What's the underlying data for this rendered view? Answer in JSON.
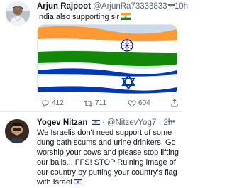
{
  "tweets": [
    {
      "display_name": "Arjun Rajpoot",
      "handle": "@ArjunRa73333833",
      "separator": "·",
      "time": "10h",
      "text": "India also supporting sir",
      "flag_emoji": "flag-india-icon",
      "media": "india-israel-flags-image",
      "stats": {
        "replies": "412",
        "retweets": "711",
        "likes": "604"
      }
    },
    {
      "display_name": "Yogev Nitzan",
      "flag_emoji": "flag-israel-icon",
      "separator": "·",
      "handle": "@NitzevYog7",
      "time": "2h",
      "text": "We Israelis don't need support of some dung bath scums and urine drinkers. Go worship your cows and please stop lifting our balls... FFS! STOP Ruining image of our country by putting your country's flag with Israel"
    }
  ],
  "colors": {
    "saffron": "#FF9933",
    "india_green": "#138808",
    "chakra_blue": "#000080",
    "israel_blue": "#0038B8",
    "text_primary": "#0f1419",
    "text_secondary": "#536471",
    "divider": "#e6ecf0"
  }
}
